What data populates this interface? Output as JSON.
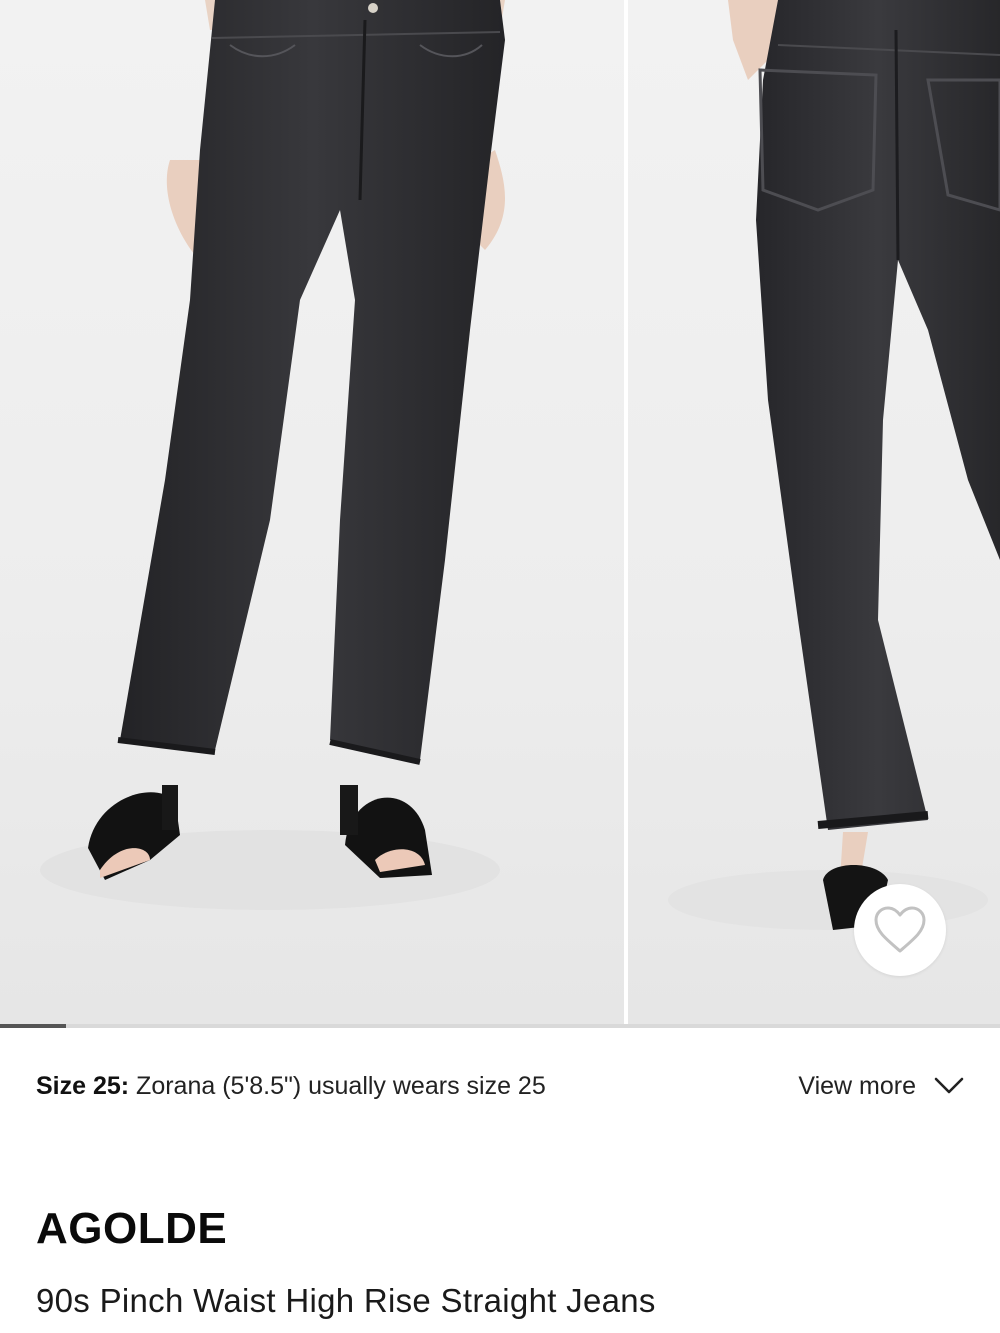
{
  "gallery": {
    "images": [
      {
        "name": "front-view",
        "description": "model wearing black high rise straight jeans, front view"
      },
      {
        "name": "back-view",
        "description": "model wearing black high rise straight jeans, back view"
      }
    ],
    "progress_fraction": 0.066
  },
  "size_info": {
    "label": "Size 25:",
    "text": " Zorana (5'8.5\") usually wears size 25"
  },
  "view_more": {
    "label": "View more",
    "icon": "chevron-down-icon"
  },
  "favorite": {
    "icon": "heart-outline-icon"
  },
  "product": {
    "brand": "AGOLDE",
    "name": "90s Pinch Waist High Rise Straight Jeans"
  },
  "colors": {
    "denim": "#2b2b2e",
    "background": "#ececec",
    "text": "#111111"
  }
}
